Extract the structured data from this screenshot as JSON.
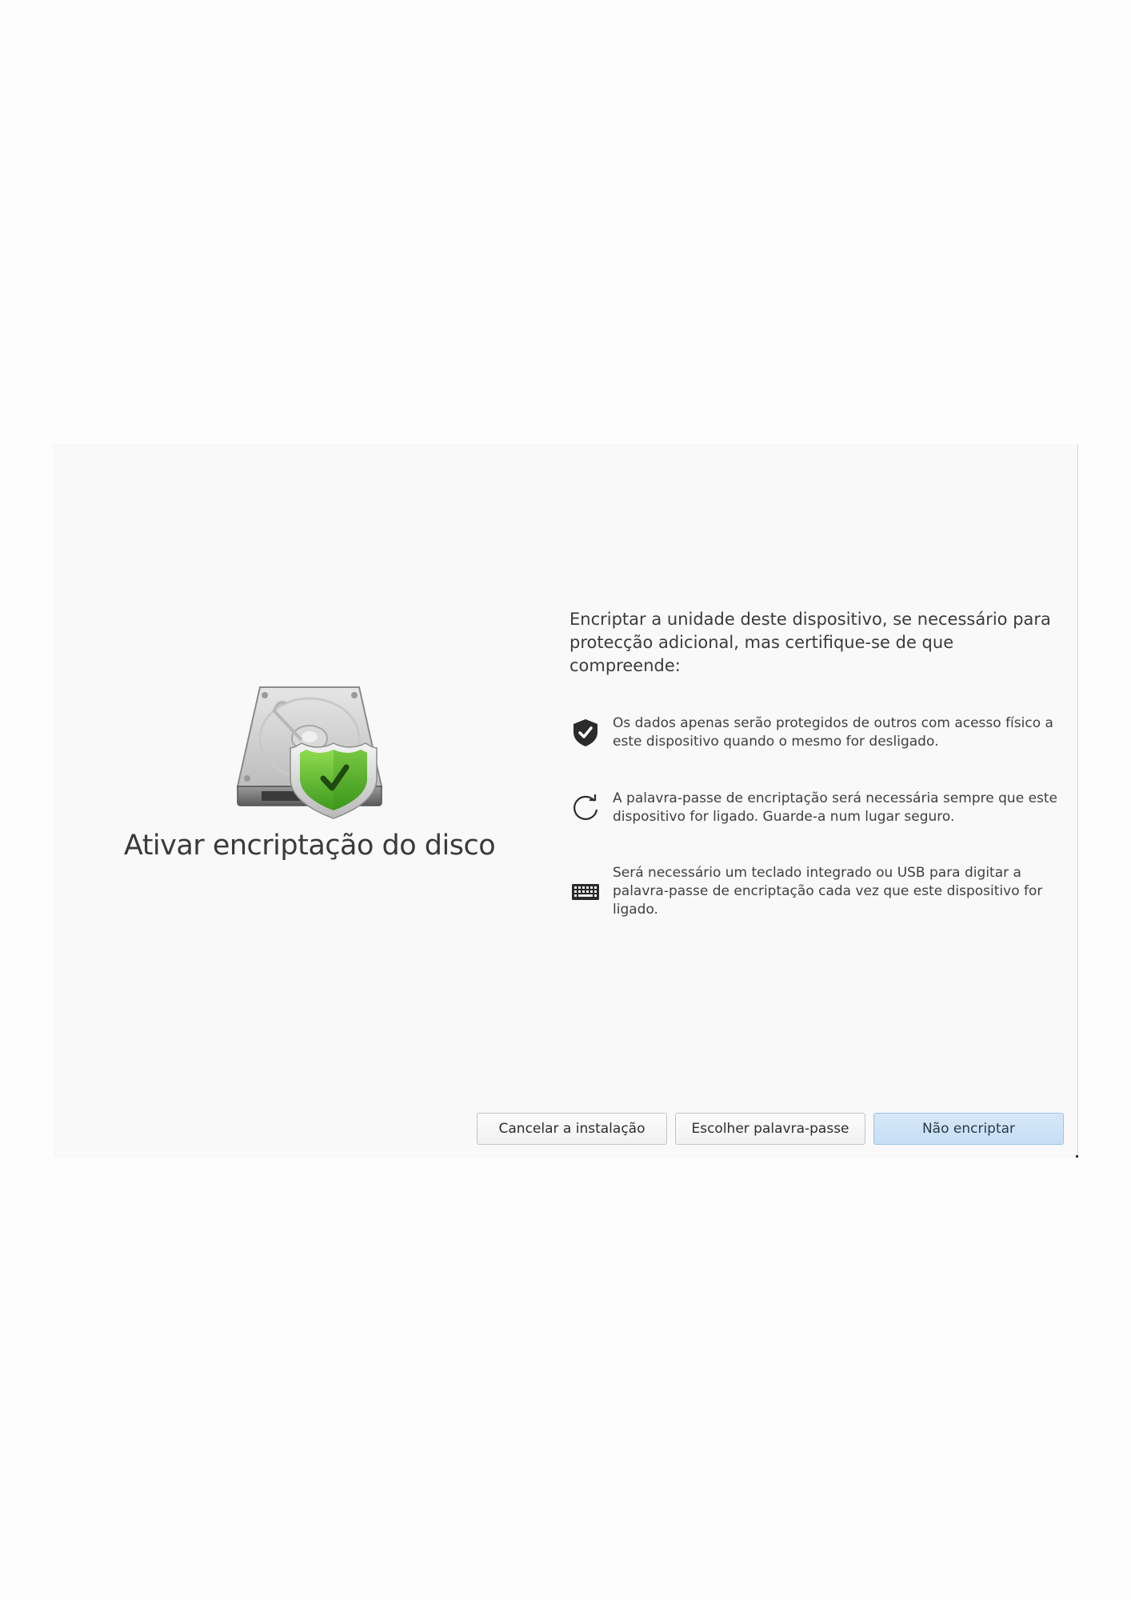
{
  "dialog": {
    "title": "Ativar encriptação do disco",
    "intro": "Encriptar a unidade deste dispositivo, se necessário para protecção adicional, mas certifique-se de que compreende:",
    "items": [
      {
        "icon": "shield-check-icon",
        "text": "Os dados apenas serão protegidos de outros com acesso físico a este dispositivo quando o mesmo for desligado."
      },
      {
        "icon": "refresh-icon",
        "text": "A palavra-passe de encriptação será necessária sempre que este dispositivo for ligado. Guarde-a num lugar seguro."
      },
      {
        "icon": "keyboard-icon",
        "text": "Será necessário um teclado integrado ou USB para digitar a palavra-passe de encriptação cada vez que este dispositivo for ligado."
      }
    ],
    "buttons": {
      "cancel": "Cancelar a instalação",
      "choose_password": "Escolher palavra-passe",
      "no_encrypt": "Não encriptar"
    },
    "colors": {
      "background": "#f9f9f9",
      "primary_button": "#c9e0f5",
      "shield_green": "#5cb82e"
    }
  }
}
